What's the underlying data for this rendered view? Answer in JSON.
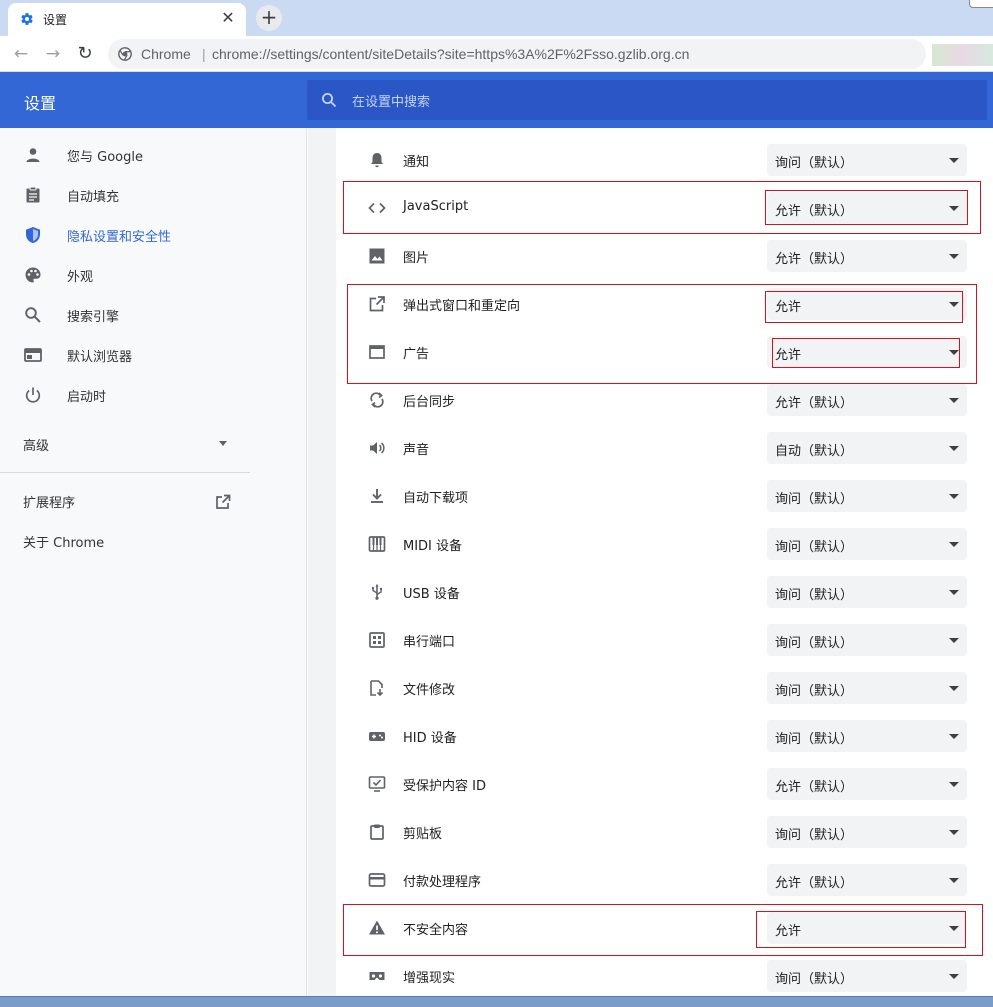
{
  "tab": {
    "title": "设置",
    "close_glyph": "✕",
    "icon": "gear-icon"
  },
  "newtab_glyph": "+",
  "toolbar": {
    "back_glyph": "←",
    "forward_glyph": "→",
    "reload_glyph": "↻",
    "omnibox_chrome": "Chrome",
    "omnibox_sep": "|",
    "omnibox_url": "chrome://settings/content/siteDetails?site=https%3A%2F%2Fsso.gzlib.org.cn",
    "star_glyph": "☆"
  },
  "header": {
    "title": "设置",
    "search_placeholder": "在设置中搜索"
  },
  "sidebar": {
    "items": [
      {
        "label": "您与 Google",
        "icon": "person-icon"
      },
      {
        "label": "自动填充",
        "icon": "clipboard-icon"
      },
      {
        "label": "隐私设置和安全性",
        "icon": "shield-icon"
      },
      {
        "label": "外观",
        "icon": "palette-icon"
      },
      {
        "label": "搜索引擎",
        "icon": "search-icon"
      },
      {
        "label": "默认浏览器",
        "icon": "browser-icon"
      },
      {
        "label": "启动时",
        "icon": "power-icon"
      }
    ],
    "active_index": 2,
    "advanced_label": "高级",
    "extensions_label": "扩展程序",
    "about_label": "关于 Chrome"
  },
  "permissions": [
    {
      "label": "通知",
      "value": "询问（默认）",
      "icon": "bell-icon"
    },
    {
      "label": "JavaScript",
      "value": "允许（默认）",
      "icon": "code-icon"
    },
    {
      "label": "图片",
      "value": "允许（默认）",
      "icon": "image-icon"
    },
    {
      "label": "弹出式窗口和重定向",
      "value": "允许",
      "icon": "popup-icon"
    },
    {
      "label": "广告",
      "value": "允许",
      "icon": "ads-icon"
    },
    {
      "label": "后台同步",
      "value": "允许（默认）",
      "icon": "sync-icon"
    },
    {
      "label": "声音",
      "value": "自动（默认）",
      "icon": "sound-icon"
    },
    {
      "label": "自动下载项",
      "value": "询问（默认）",
      "icon": "download-icon"
    },
    {
      "label": "MIDI 设备",
      "value": "询问（默认）",
      "icon": "piano-icon"
    },
    {
      "label": "USB 设备",
      "value": "询问（默认）",
      "icon": "usb-icon"
    },
    {
      "label": "串行端口",
      "value": "询问（默认）",
      "icon": "serial-port-icon"
    },
    {
      "label": "文件修改",
      "value": "询问（默认）",
      "icon": "file-edit-icon"
    },
    {
      "label": "HID 设备",
      "value": "询问（默认）",
      "icon": "gamepad-icon"
    },
    {
      "label": "受保护内容 ID",
      "value": "允许（默认）",
      "icon": "protected-content-icon"
    },
    {
      "label": "剪贴板",
      "value": "询问（默认）",
      "icon": "clipboard-icon"
    },
    {
      "label": "付款处理程序",
      "value": "允许（默认）",
      "icon": "credit-card-icon"
    },
    {
      "label": "不安全内容",
      "value": "允许",
      "icon": "warning-icon"
    },
    {
      "label": "增强现实",
      "value": "询问（默认）",
      "icon": "vr-icon"
    }
  ],
  "colors": {
    "header": "#3367d6",
    "search": "#2a56c6",
    "highlight": "#d0161c",
    "active_text": "#3367d6"
  }
}
